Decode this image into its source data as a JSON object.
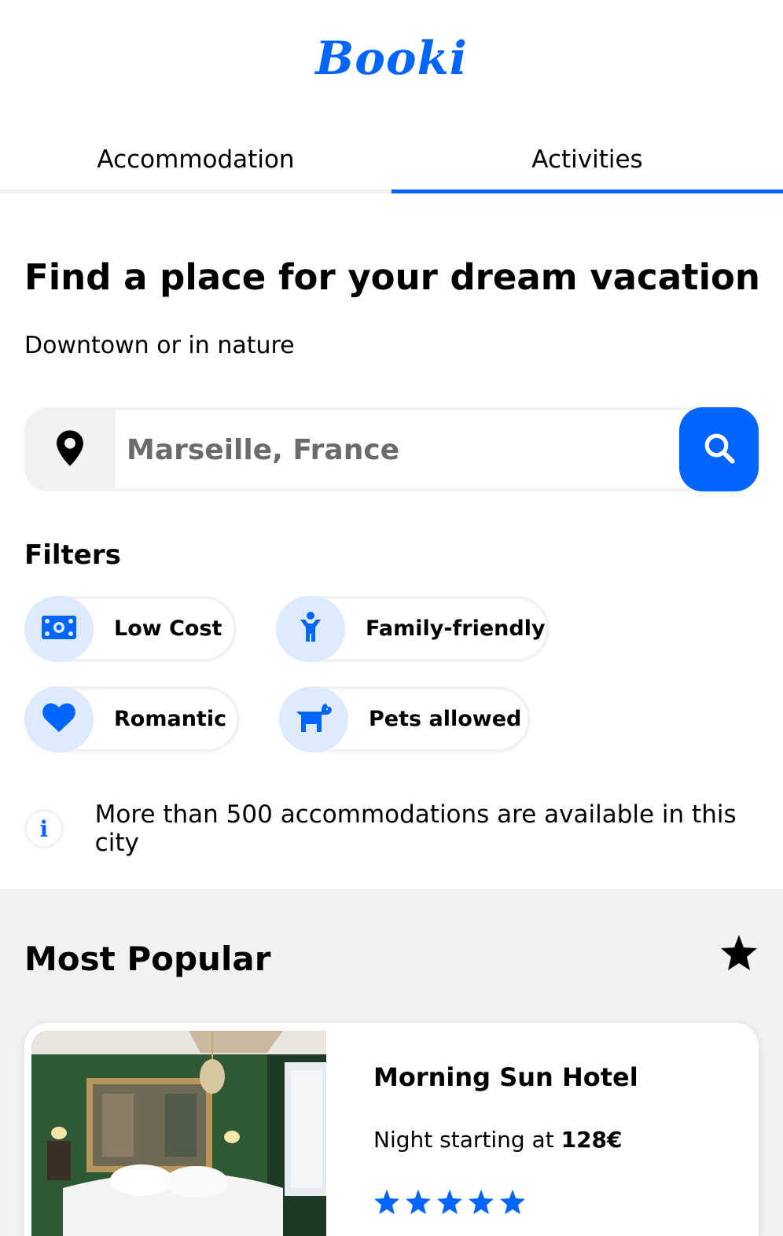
{
  "app": {
    "logo": "Booki",
    "brand_color": "#0065fc"
  },
  "tabs": [
    {
      "label": "Accommodation",
      "active": false
    },
    {
      "label": "Activities",
      "active": true
    }
  ],
  "hero": {
    "headline": "Find a place for your dream vacation",
    "subline": "Downtown or in nature"
  },
  "search": {
    "placeholder": "Marseille, France",
    "value": "",
    "location_icon": "map-pin-icon",
    "button_icon": "search-icon"
  },
  "filters": {
    "title": "Filters",
    "items": [
      {
        "label": "Low Cost",
        "icon": "money-bill-icon"
      },
      {
        "label": "Family-friendly",
        "icon": "child-icon"
      },
      {
        "label": "Romantic",
        "icon": "heart-icon"
      },
      {
        "label": "Pets allowed",
        "icon": "dog-icon"
      }
    ]
  },
  "info": {
    "icon": "info-icon",
    "glyph": "i",
    "text": "More than 500 accommodations are available in this city"
  },
  "popular": {
    "title": "Most Popular",
    "icon": "star-icon",
    "cards": [
      {
        "name": "Morning Sun Hotel",
        "price_prefix": "Night starting at",
        "price": "128€",
        "rating": 5
      }
    ]
  }
}
